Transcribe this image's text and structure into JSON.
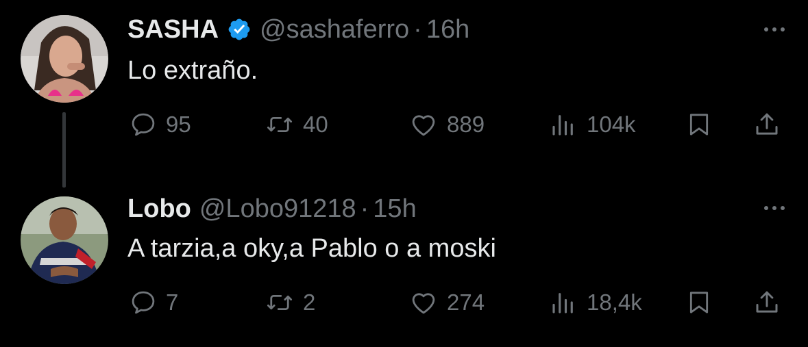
{
  "tweets": [
    {
      "name": "SASHA",
      "verified": true,
      "handle": "@sashaferro",
      "separator": "·",
      "time": "16h",
      "text": "Lo extraño.",
      "avatar_icon": "avatar-photo",
      "stats": {
        "replies": "95",
        "reposts": "40",
        "likes": "889",
        "views": "104k"
      }
    },
    {
      "name": "Lobo",
      "verified": false,
      "handle": "@Lobo91218",
      "separator": "·",
      "time": "15h",
      "text": "A tarzia,a oky,a Pablo o a moski",
      "avatar_icon": "avatar-photo",
      "stats": {
        "replies": "7",
        "reposts": "2",
        "likes": "274",
        "views": "18,4k"
      }
    }
  ],
  "icons": [
    "reply-icon",
    "repost-icon",
    "like-icon",
    "views-icon",
    "bookmark-icon",
    "share-icon",
    "more-icon",
    "verified-icon"
  ],
  "colors": {
    "background": "#000000",
    "primary_text": "#e7e9ea",
    "secondary_text": "#71767b",
    "verified_badge": "#1d9bf0",
    "thread_line": "#333639"
  }
}
